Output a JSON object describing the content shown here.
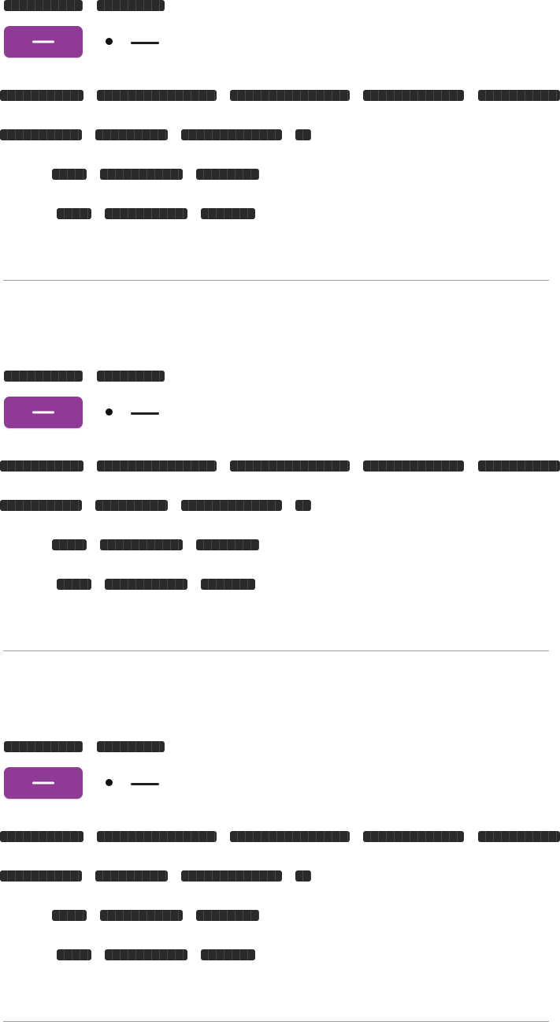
{
  "colors": {
    "accent": "#8f3a94",
    "redaction": "#2a2a2a",
    "divider": "#9c9c9c"
  },
  "cards": [
    {
      "title": [
        "",
        ""
      ],
      "action_label": "",
      "status": "",
      "line1": [
        "",
        "",
        "",
        "",
        ""
      ],
      "line2": [
        "",
        "",
        "",
        ""
      ],
      "line3": [
        "",
        "",
        ""
      ],
      "line4": [
        "",
        "",
        ""
      ]
    },
    {
      "title": [
        "",
        ""
      ],
      "action_label": "",
      "status": "",
      "line1": [
        "",
        "",
        "",
        "",
        ""
      ],
      "line2": [
        "",
        "",
        "",
        ""
      ],
      "line3": [
        "",
        "",
        ""
      ],
      "line4": [
        "",
        "",
        ""
      ]
    },
    {
      "title": [
        "",
        ""
      ],
      "action_label": "",
      "status": "",
      "line1": [
        "",
        "",
        "",
        "",
        ""
      ],
      "line2": [
        "",
        "",
        "",
        ""
      ],
      "line3": [
        "",
        "",
        ""
      ],
      "line4": [
        "",
        "",
        ""
      ]
    }
  ]
}
